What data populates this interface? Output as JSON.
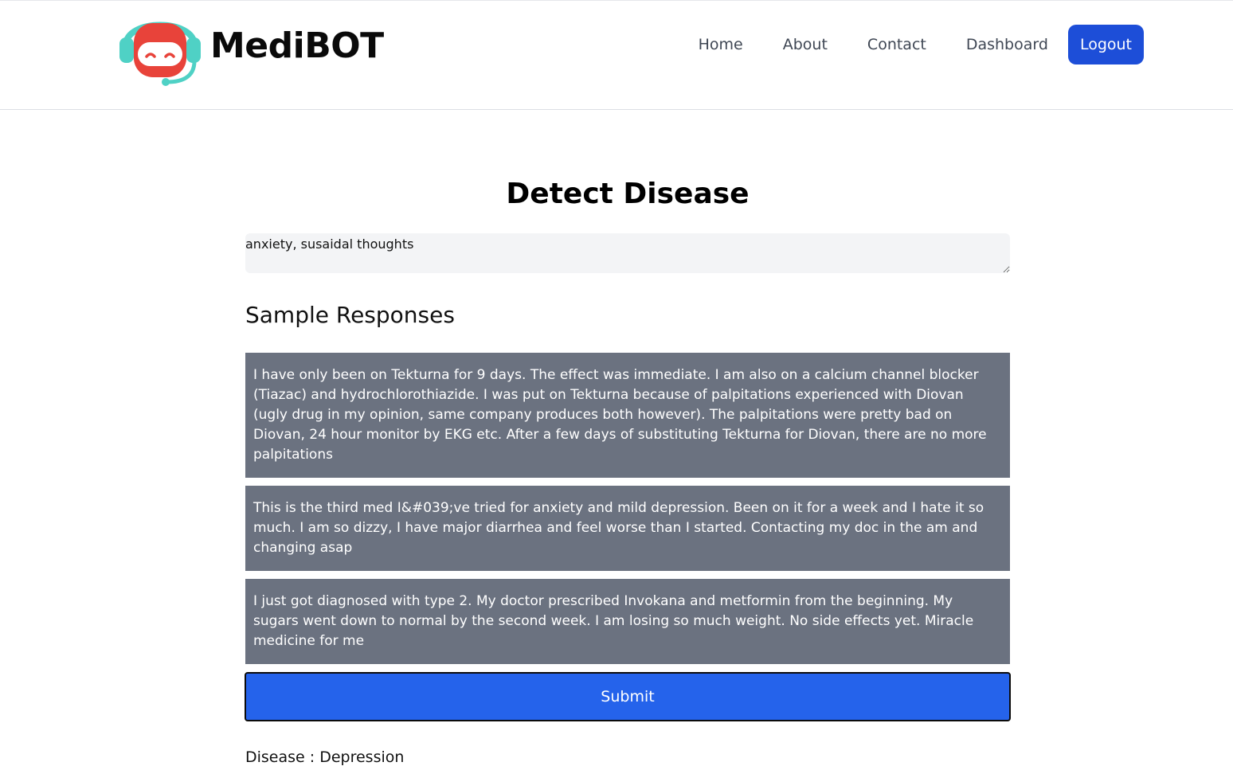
{
  "header": {
    "brand_name": "MediBOT",
    "logo_icon": "robot-headset-icon",
    "nav": [
      {
        "label": "Home"
      },
      {
        "label": "About"
      },
      {
        "label": "Contact"
      },
      {
        "label": "Dashboard"
      }
    ],
    "logout_label": "Logout"
  },
  "main": {
    "title": "Detect Disease",
    "symptom_input": {
      "value": "anxiety, susaidal thoughts",
      "placeholder": ""
    },
    "sample_heading": "Sample Responses",
    "samples": [
      {
        "text": "I have only been on Tekturna for 9 days. The effect was immediate. I am also on a calcium channel blocker (Tiazac) and hydrochlorothiazide. I was put on Tekturna because of palpitations experienced with Diovan (ugly drug in my opinion, same company produces both however). The palpitations were pretty bad on Diovan, 24 hour monitor by EKG etc. After a few days of substituting Tekturna for Diovan, there are no more palpitations"
      },
      {
        "text": "This is the third med I&#039;ve tried for anxiety and mild depression. Been on it for a week and I hate it so much. I am so dizzy, I have major diarrhea and feel worse than I started. Contacting my doc in the am and changing asap"
      },
      {
        "text": "I just got diagnosed with type 2. My doctor prescribed Invokana and metformin from the beginning. My sugars went down to normal by the second week. I am losing so much weight. No side effects yet. Miracle medicine for me"
      }
    ],
    "submit_label": "Submit",
    "result_text": "Disease : Depression"
  },
  "colors": {
    "primary": "#2563eb",
    "logout": "#1d4ed8",
    "card_bg": "#6b7280",
    "input_bg": "#f3f4f6",
    "logo_red": "#e8433a",
    "logo_teal": "#4fd1c5"
  }
}
